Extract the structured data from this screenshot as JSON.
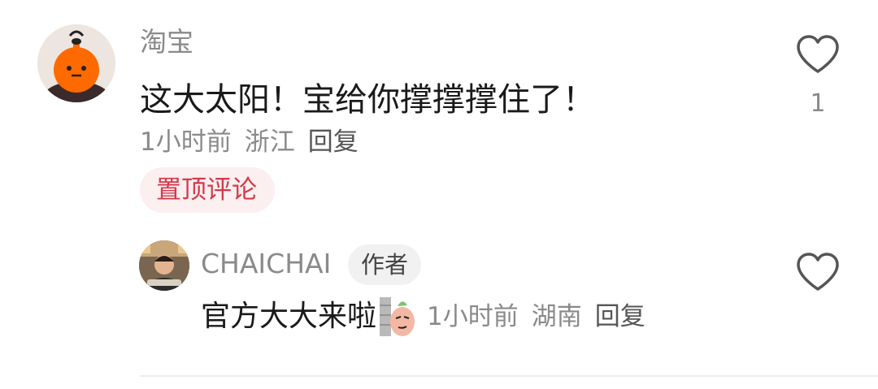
{
  "main_comment": {
    "username": "淘宝",
    "text": "这大太阳！宝给你撑撑撑住了！",
    "time": "1小时前",
    "location": "浙江",
    "reply_label": "回复",
    "pinned_label": "置顶评论",
    "like_count": "1",
    "avatar_icon": "orange-mascot-avatar",
    "like_icon": "heart-outline-icon",
    "colors": {
      "pinned_text": "#d7374a",
      "pinned_bg": "#fbeff0"
    }
  },
  "reply_comment": {
    "username": "CHAICHAI",
    "author_badge": "作者",
    "text": "官方大大来啦",
    "sticker_icon": "peeking-sticker-icon",
    "time": "1小时前",
    "location": "湖南",
    "reply_label": "回复",
    "avatar_icon": "person-photo-avatar",
    "like_icon": "heart-outline-icon"
  }
}
